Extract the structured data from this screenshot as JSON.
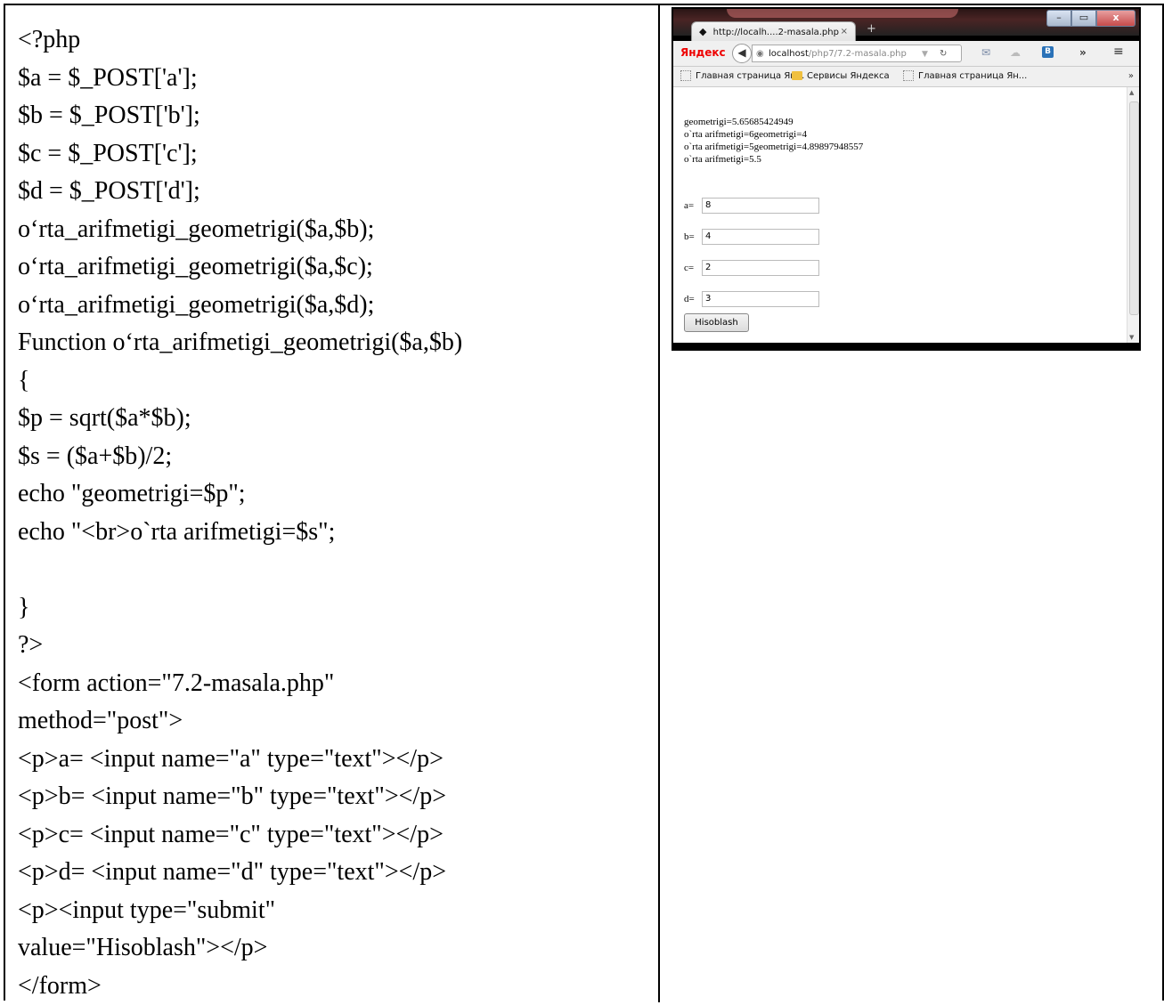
{
  "code_lines": [
    "<?php",
    "$a = $_POST['a'];",
    "$b = $_POST['b'];",
    "$c = $_POST['c'];",
    "$d = $_POST['d'];",
    "o‘rta_arifmetigi_geometrigi($a,$b);",
    "o‘rta_arifmetigi_geometrigi($a,$c);",
    "o‘rta_arifmetigi_geometrigi($a,$d);",
    "Function o‘rta_arifmetigi_geometrigi($a,$b)",
    "{",
    "$p = sqrt($a*$b);",
    "$s = ($a+$b)/2;",
    "echo \"geometrigi=$p\";",
    "echo \"<br>o`rta arifmetigi=$s\";",
    "",
    "}",
    "?>",
    "<form action=\"7.2-masala.php\"",
    "method=\"post\">",
    "<p>a= <input name=\"a\" type=\"text\"></p>",
    "<p>b= <input name=\"b\" type=\"text\"></p>",
    "<p>c= <input name=\"c\" type=\"text\"></p>",
    "<p>d= <input name=\"d\" type=\"text\"></p>",
    "<p><input type=\"submit\"",
    "value=\"Hisoblash\"></p>",
    "</form>"
  ],
  "browser": {
    "window_controls": {
      "minimize": "–",
      "maximize": "▭",
      "close": "x"
    },
    "tab": {
      "title": "http://localh....2-masala.php",
      "close": "×",
      "new_tab": "+"
    },
    "toolbar": {
      "brand": "Яндекс",
      "url_host": "localhost",
      "url_path": "/php7/7.2-masala.php",
      "more": "»",
      "menu": "≡"
    },
    "bookmarks": [
      "Главная страница Ян...",
      "Сервисы Яндекса",
      "Главная страница Ян..."
    ],
    "bookmarks_more": "»",
    "output_lines": [
      "geometrigi=5.65685424949",
      "o`rta arifmetigi=6geometrigi=4",
      "o`rta arifmetigi=5geometrigi=4.89897948557",
      "o`rta arifmetigi=5.5"
    ],
    "form": {
      "fields": [
        {
          "label": "a=",
          "value": "8"
        },
        {
          "label": "b=",
          "value": "4"
        },
        {
          "label": "c=",
          "value": "2"
        },
        {
          "label": "d=",
          "value": "3"
        }
      ],
      "submit_label": "Hisoblash"
    }
  }
}
